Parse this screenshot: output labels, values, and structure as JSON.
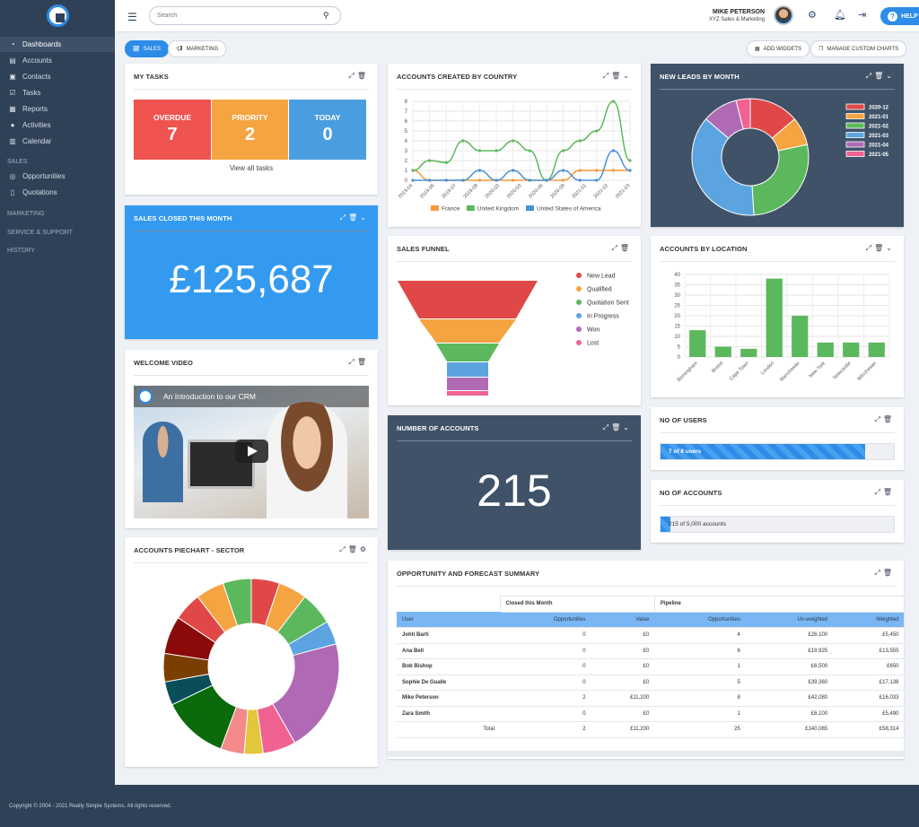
{
  "sidebar": {
    "items": [
      {
        "label": "Dashboards",
        "icon": "dashboard-icon"
      },
      {
        "label": "Accounts",
        "icon": "briefcase-icon"
      },
      {
        "label": "Contacts",
        "icon": "contacts-icon"
      },
      {
        "label": "Tasks",
        "icon": "check-icon"
      },
      {
        "label": "Reports",
        "icon": "chart-icon"
      },
      {
        "label": "Activities",
        "icon": "chat-icon"
      },
      {
        "label": "Calendar",
        "icon": "calendar-icon"
      }
    ],
    "sales_header": "SALES",
    "sales_items": [
      {
        "label": "Opportunities"
      },
      {
        "label": "Quotations"
      }
    ],
    "sections": [
      "MARKETING",
      "SERVICE & SUPPORT",
      "HISTORY"
    ]
  },
  "topbar": {
    "search_placeholder": "Search",
    "user_name": "MIKE PETERSON",
    "user_company": "XYZ Sales & Marketing",
    "help_label": "HELP"
  },
  "tabs": {
    "sales": "SALES",
    "marketing": "MARKETING",
    "add_widgets": "ADD WIDGETS",
    "manage_charts": "MANAGE CUSTOM CHARTS"
  },
  "my_tasks": {
    "title": "MY TASKS",
    "boxes": [
      {
        "label": "OVERDUE",
        "value": "7",
        "color": "#ef5350"
      },
      {
        "label": "PRIORITY",
        "value": "2",
        "color": "#f5a442"
      },
      {
        "label": "TODAY",
        "value": "0",
        "color": "#4a9ee0"
      }
    ],
    "link": "View all tasks"
  },
  "sales_closed": {
    "title": "SALES CLOSED THIS MONTH",
    "value": "£125,687"
  },
  "welcome_video": {
    "title": "WELCOME VIDEO",
    "video_title": "An Introduction to our CRM"
  },
  "sector_pie": {
    "title": "ACCOUNTS PIECHART - SECTOR"
  },
  "accounts_by_country": {
    "title": "ACCOUNTS CREATED BY COUNTRY"
  },
  "sales_funnel": {
    "title": "SALES FUNNEL"
  },
  "number_of_accounts": {
    "title": "NUMBER OF ACCOUNTS",
    "value": "215"
  },
  "new_leads": {
    "title": "NEW LEADS BY MONTH"
  },
  "accounts_by_location": {
    "title": "ACCOUNTS BY LOCATION"
  },
  "no_of_users": {
    "title": "NO OF USERS",
    "text": "7 of 8 users",
    "fraction": 0.875
  },
  "no_of_accounts": {
    "title": "NO OF ACCOUNTS",
    "text": "215 of 5,000 accounts",
    "fraction": 0.043
  },
  "forecast": {
    "title": "OPPORTUNITY AND FORECAST SUMMARY",
    "group_headers": [
      "Closed this Month",
      "Pipeline"
    ],
    "columns": [
      "User",
      "Opportunities",
      "Value",
      "Opportunities",
      "Un-weighted",
      "Weighted"
    ],
    "rows": [
      [
        "Johti Barti",
        "0",
        "£0",
        "4",
        "£26,100",
        "£5,450"
      ],
      [
        "Ana Bell",
        "0",
        "£0",
        "6",
        "£19,925",
        "£13,555"
      ],
      [
        "Bob Bishop",
        "0",
        "£0",
        "1",
        "£6,500",
        "£650"
      ],
      [
        "Sophie De Gualle",
        "0",
        "£0",
        "5",
        "£39,360",
        "£17,136"
      ],
      [
        "Mike Peterson",
        "2",
        "£11,200",
        "8",
        "£42,080",
        "£16,033"
      ],
      [
        "Zara Smith",
        "0",
        "£0",
        "1",
        "£6,100",
        "£5,490"
      ]
    ],
    "total": [
      "Total",
      "2",
      "£11,200",
      "25",
      "£140,065",
      "£58,314"
    ]
  },
  "footer": {
    "text": "Copyright © 2004 - 2021 Really Simple Systems. All rights reserved."
  },
  "chart_data": [
    {
      "id": "country",
      "type": "line",
      "title": "ACCOUNTS CREATED BY COUNTRY",
      "x": [
        "2019-04",
        "2019-05",
        "2019-06",
        "2019-07",
        "2019-08",
        "2019-09",
        "2020-02",
        "2020-03",
        "2020-06",
        "2020-09",
        "2020-10",
        "2021-01",
        "2021-02",
        "2021-03"
      ],
      "x_tick_labels": [
        "2019-04",
        "2019-06",
        "2019-07",
        "2019-08",
        "2020-02",
        "2020-03",
        "2020-06",
        "2020-09",
        "2021-01",
        "2021-02",
        "2021-03"
      ],
      "ylim": [
        0,
        8
      ],
      "y_ticks": [
        0,
        1,
        2,
        3,
        4,
        5,
        6,
        7,
        8
      ],
      "grid": true,
      "legend": "bottom",
      "series": [
        {
          "name": "France",
          "color": "#f59b3a",
          "values": [
            1,
            0,
            0,
            0,
            0,
            0,
            0,
            0,
            0,
            0,
            1,
            1,
            1,
            1
          ]
        },
        {
          "name": "United Kingdom",
          "color": "#5cb85c",
          "values": [
            1,
            2,
            1.8,
            4,
            3,
            3,
            4,
            3,
            0,
            3,
            4,
            5,
            8,
            2
          ]
        },
        {
          "name": "United States of America",
          "color": "#4a90d9",
          "values": [
            0,
            0,
            0,
            0,
            1,
            0,
            1,
            0,
            0,
            1,
            0,
            0,
            3,
            1
          ]
        }
      ]
    },
    {
      "id": "funnel",
      "type": "funnel",
      "title": "SALES FUNNEL",
      "legend": "right",
      "stages": [
        {
          "name": "New Lead",
          "color": "#e04848",
          "value": 5
        },
        {
          "name": "Qualified",
          "color": "#f5a442",
          "value": 4
        },
        {
          "name": "Quotation Sent",
          "color": "#5cb85c",
          "value": 3
        },
        {
          "name": "In Progress",
          "color": "#5ba4e0",
          "value": 2
        },
        {
          "name": "Won",
          "color": "#b06ab3",
          "value": 1.5
        },
        {
          "name": "Lost",
          "color": "#f06292",
          "value": 0.5
        }
      ]
    },
    {
      "id": "leads",
      "type": "pie",
      "title": "NEW LEADS BY MONTH",
      "legend": "right",
      "categories": [
        "2020-12",
        "2021-01",
        "2021-02",
        "2021-03",
        "2021-04",
        "2021-05"
      ],
      "values": [
        14,
        8,
        28,
        38,
        10,
        4
      ],
      "colors": [
        "#e04848",
        "#f5a442",
        "#5cb85c",
        "#5ba4e0",
        "#b06ab3",
        "#f06292"
      ]
    },
    {
      "id": "location",
      "type": "bar",
      "title": "ACCOUNTS BY LOCATION",
      "ylim": [
        0,
        40
      ],
      "y_ticks": [
        0,
        5,
        10,
        15,
        20,
        25,
        30,
        35,
        40
      ],
      "grid": true,
      "categories": [
        "Birmingham",
        "Bristol",
        "Cape Town",
        "London",
        "Manchester",
        "New York",
        "Newcastle",
        "Winchester"
      ],
      "values": [
        13,
        5,
        4,
        38,
        20,
        7,
        7,
        7
      ],
      "color": "#5cb85c"
    },
    {
      "id": "sector",
      "type": "pie",
      "title": "ACCOUNTS PIECHART - SECTOR",
      "values": [
        6,
        6,
        7,
        5,
        24,
        7,
        4,
        5,
        14,
        5,
        6,
        8,
        6,
        6,
        6
      ],
      "colors": [
        "#e04848",
        "#f5a442",
        "#5cb85c",
        "#5ba4e0",
        "#b06ab3",
        "#f06292",
        "#e2c73a",
        "#f48a8a",
        "#0b6a0b",
        "#0a4e5a",
        "#7a3e00",
        "#8a0a0a",
        "#e04848",
        "#f5a442",
        "#5cb85c"
      ]
    }
  ]
}
